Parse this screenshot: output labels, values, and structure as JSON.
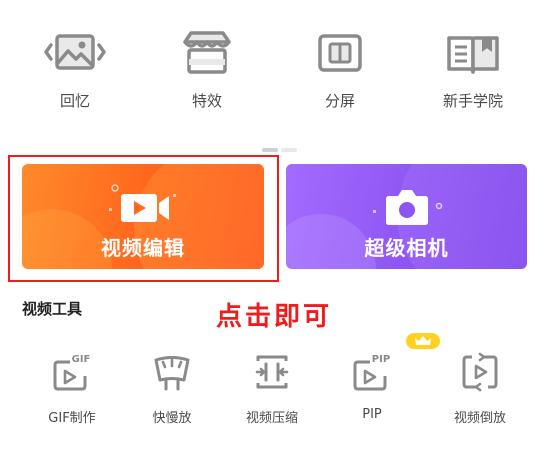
{
  "top_tools": [
    {
      "label": "回忆",
      "icon": "photo-memory-icon"
    },
    {
      "label": "特效",
      "icon": "effects-shop-icon"
    },
    {
      "label": "分屏",
      "icon": "split-screen-icon"
    },
    {
      "label": "新手学院",
      "icon": "book-icon"
    }
  ],
  "cards": {
    "video_edit": {
      "label": "视频编辑",
      "icon": "video-camera-icon"
    },
    "super_camera": {
      "label": "超级相机",
      "icon": "camera-icon"
    }
  },
  "section_title": "视频工具",
  "annotation": "点击即可",
  "video_tools": [
    {
      "label": "GIF制作",
      "icon": "gif-icon",
      "icon_text": "GIF"
    },
    {
      "label": "快慢放",
      "icon": "speed-gauge-icon"
    },
    {
      "label": "视频压缩",
      "icon": "compress-icon"
    },
    {
      "label": "PIP",
      "icon": "pip-icon",
      "icon_text": "PIP"
    },
    {
      "label": "视频倒放",
      "icon": "reverse-icon"
    }
  ],
  "colors": {
    "accent_red": "#f01c1c",
    "video_card": "#ff6a1e",
    "camera_card": "#8e54f2",
    "badge": "#ffd21f",
    "icon_gray": "#8a8a8a"
  }
}
